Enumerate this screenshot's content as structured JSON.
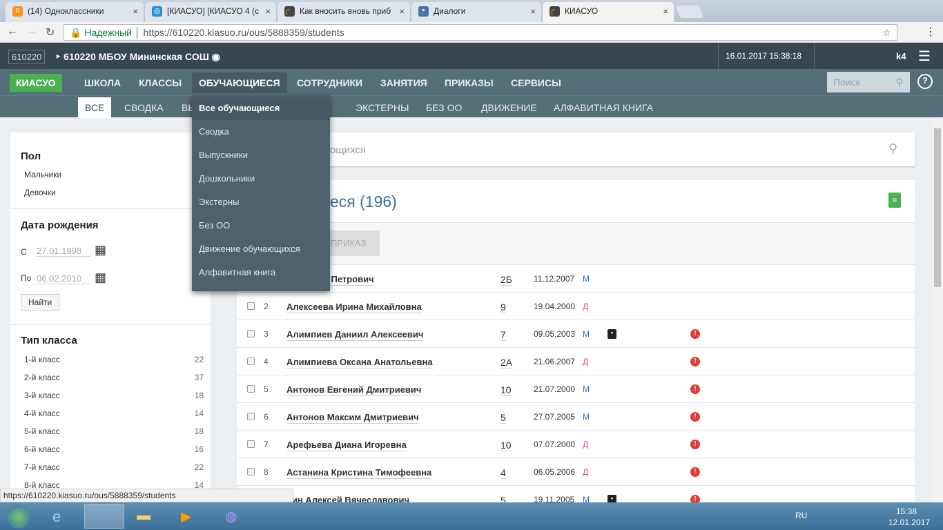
{
  "browser": {
    "tabs": [
      {
        "label": "(14) Одноклассники",
        "active": false
      },
      {
        "label": "[КИАСУО] [КИАСУО 4 (с",
        "active": false
      },
      {
        "label": "Как вносить вновь приб",
        "active": false
      },
      {
        "label": "Диалоги",
        "active": false
      },
      {
        "label": "КИАСУО",
        "active": true
      }
    ],
    "secure_label": "Надежный",
    "url": "https://610220.kiasuo.ru/ous/5888359/students",
    "status_url": "https://610220.kiasuo.ru/ous/5888359/students"
  },
  "header": {
    "code": "610220",
    "school": "610220 МБОУ Мининская СОШ",
    "datetime": "16.01.2017 15:38:18",
    "user": "k4"
  },
  "nav": {
    "logo": "КИАСУО",
    "items": [
      "ШКОЛА",
      "КЛАССЫ",
      "ОБУЧАЮЩИЕСЯ",
      "СОТРУДНИКИ",
      "ЗАНЯТИЯ",
      "ПРИКАЗЫ",
      "СЕРВИСЫ"
    ],
    "search_placeholder": "Поиск",
    "active": "ОБУЧАЮЩИЕСЯ"
  },
  "subnav": {
    "items": [
      "ВСЕ",
      "СВОДКА",
      "ВЫ",
      "И",
      "ЭКСТЕРНЫ",
      "БЕЗ ОО",
      "ДВИЖЕНИЕ",
      "АЛФАВИТНАЯ КНИГА"
    ]
  },
  "dropdown": {
    "items": [
      "Все обучающиеся",
      "Сводка",
      "Выпускники",
      "Дошкольники",
      "Экстерны",
      "Без ОО",
      "Движение обучающихся",
      "Алфавитная книга"
    ]
  },
  "filters": {
    "gender_title": "Пол",
    "genders": [
      "Мальчики",
      "Девочки"
    ],
    "birth_title": "Дата рождения",
    "from_label": "С",
    "from_value": "27.01.1998",
    "to_label": "По",
    "to_value": "06.02.2010",
    "find_button": "Найти",
    "class_type_title": "Тип класса",
    "class_types": [
      {
        "label": "1-й класс",
        "count": "22"
      },
      {
        "label": "2-й класс",
        "count": "37"
      },
      {
        "label": "3-й класс",
        "count": "18"
      },
      {
        "label": "4-й класс",
        "count": "14"
      },
      {
        "label": "5-й класс",
        "count": "18"
      },
      {
        "label": "6-й класс",
        "count": "16"
      },
      {
        "label": "7-й класс",
        "count": "22"
      },
      {
        "label": "8-й класс",
        "count": "14"
      }
    ]
  },
  "main": {
    "search_placeholder": "ощихся",
    "title": "еся (196)",
    "order_button": "ПРИКАЗ",
    "students": [
      {
        "num": "",
        "name": "н Максим Петрович",
        "class": "2Б",
        "dob": "11.12.2007",
        "sex": "М",
        "badge": false,
        "alert": false
      },
      {
        "num": "2",
        "name": "Алексеева Ирина Михайловна",
        "class": "9",
        "dob": "19.04.2000",
        "sex": "Д",
        "badge": false,
        "alert": false
      },
      {
        "num": "3",
        "name": "Алимпиев Даниил Алексеевич",
        "class": "7",
        "dob": "09.05.2003",
        "sex": "М",
        "badge": true,
        "alert": true
      },
      {
        "num": "4",
        "name": "Алимпиева Оксана Анатольевна",
        "class": "2А",
        "dob": "21.06.2007",
        "sex": "Д",
        "badge": false,
        "alert": true
      },
      {
        "num": "5",
        "name": "Антонов Евгений Дмитриевич",
        "class": "10",
        "dob": "21.07.2000",
        "sex": "М",
        "badge": false,
        "alert": true
      },
      {
        "num": "6",
        "name": "Антонов Максим Дмитриевич",
        "class": "5",
        "dob": "27.07.2005",
        "sex": "М",
        "badge": false,
        "alert": true
      },
      {
        "num": "7",
        "name": "Арефьева Диана Игоревна",
        "class": "10",
        "dob": "07.07.2000",
        "sex": "Д",
        "badge": false,
        "alert": true
      },
      {
        "num": "8",
        "name": "Астанина Кристина Тимофеевна",
        "class": "4",
        "dob": "06.05.2006",
        "sex": "Д",
        "badge": false,
        "alert": true
      },
      {
        "num": "",
        "name": "нин Алексей Вячеславович",
        "class": "5",
        "dob": "19.11.2005",
        "sex": "М",
        "badge": true,
        "alert": true
      }
    ]
  },
  "taskbar": {
    "lang": "RU",
    "time": "15:38",
    "date": "12.01.2017"
  },
  "colors": {
    "logo": "#4caf50",
    "male": "#1e6fb5",
    "female": "#e0457b",
    "alert": "#e53935"
  }
}
